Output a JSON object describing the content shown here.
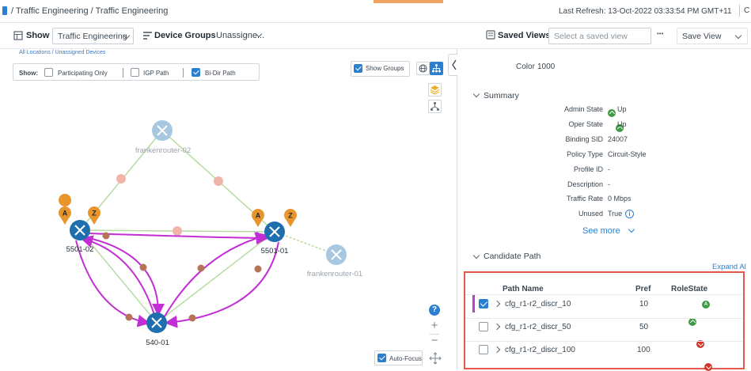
{
  "breadcrumb": {
    "text": "/ Traffic Engineering / Traffic Engineering"
  },
  "refresh": {
    "text": "Last Refresh: 13-Oct-2022 03:33:54 PM GMT+11",
    "tail": "C"
  },
  "toolbar": {
    "show_label": "Show",
    "show_value": "Traffic Engineering",
    "device_groups_label": "Device Groups",
    "device_groups_value": "Unassigne...",
    "saved_views_label": "Saved Views",
    "saved_view_placeholder": "Select a saved view",
    "more": "•••",
    "save_view": "Save View"
  },
  "map": {
    "all_locations": "All Locations / Unassigned Devices",
    "show_label": "Show:",
    "participating_only": "Participating Only",
    "igp_path": "IGP Path",
    "bi_dir_path": "Bi-Dir Path",
    "show_groups": "Show Groups",
    "auto_focus": "Auto-Focus",
    "help": "?",
    "zoom_in": "+",
    "zoom_out": "−",
    "nodes": {
      "frankenrouter_02": "frankenrouter-02",
      "frankenrouter_01": "frankenrouter-01",
      "n5501_02": "5501-02",
      "n5501_01": "5501-01",
      "n540_01": "540-01"
    },
    "marker_a": "A",
    "marker_z": "Z",
    "colors": {
      "path": "#c22fd4",
      "link": "#b7dca2",
      "node": "#1f6fae",
      "node_faded": "#a8c7e0",
      "marker": "#e8952c",
      "midpoint": "#b5735a"
    }
  },
  "details": {
    "color_label": "Color",
    "color_value": "1000",
    "summary_title": "Summary",
    "fields": [
      {
        "label": "Admin State",
        "value": "Up",
        "icon": "up-icon"
      },
      {
        "label": "Oper State",
        "value": "Up",
        "icon": "up-icon"
      },
      {
        "label": "Binding SID",
        "value": "24007"
      },
      {
        "label": "Policy Type",
        "value": "Circuit-Style"
      },
      {
        "label": "Profile ID",
        "value": "-"
      },
      {
        "label": "Description",
        "value": "-"
      },
      {
        "label": "Traffic Rate",
        "value": "0 Mbps"
      },
      {
        "label": "Unused",
        "value": "True",
        "icon": "info-icon"
      }
    ],
    "see_more": "See more",
    "candidate_path_title": "Candidate Path",
    "expand_all": "Expand Al"
  },
  "candidate_table": {
    "headers": {
      "path_name": "Path Name",
      "pref": "Pref",
      "role_state": "Role",
      "state": "State"
    },
    "rows": [
      {
        "name": "cfg_r1-r2_discr_10",
        "pref": "10",
        "checked": true,
        "state": "up"
      },
      {
        "name": "cfg_r1-r2_discr_50",
        "pref": "50",
        "checked": false,
        "state": "down"
      },
      {
        "name": "cfg_r1-r2_discr_100",
        "pref": "100",
        "checked": false,
        "state": "down"
      }
    ]
  }
}
